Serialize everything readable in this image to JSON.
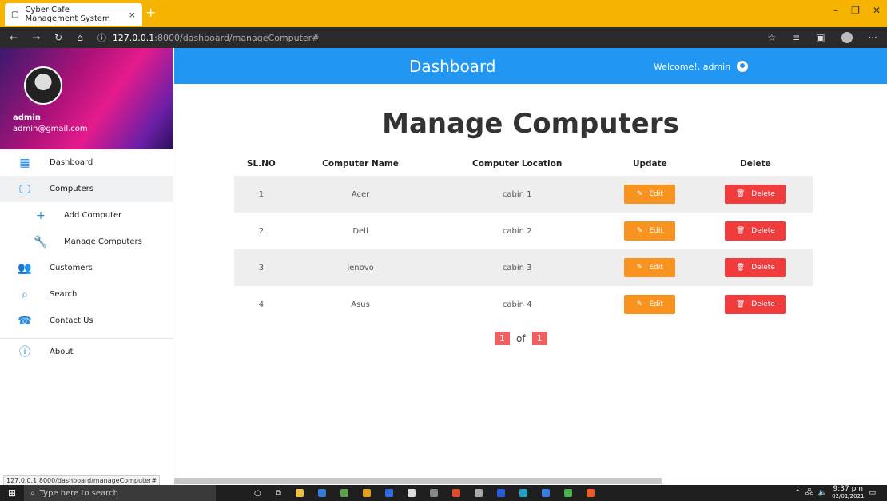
{
  "browser": {
    "tab_title": "Cyber Cafe Management System",
    "tab_close": "×",
    "new_tab": "+",
    "url_host": "127.0.0.1",
    "url_path": ":8000/dashboard/manageComputer#",
    "status_url": "127.0.0.1:8000/dashboard/manageComputer#"
  },
  "sidebar": {
    "name": "admin",
    "email": "admin@gmail.com",
    "items": [
      {
        "label": "Dashboard"
      },
      {
        "label": "Computers"
      },
      {
        "label": "Add Computer"
      },
      {
        "label": "Manage Computers"
      },
      {
        "label": "Customers"
      },
      {
        "label": "Search"
      },
      {
        "label": "Contact Us"
      },
      {
        "label": "About"
      }
    ]
  },
  "header": {
    "title": "Dashboard",
    "welcome": "Welcome!, admin"
  },
  "main": {
    "page_title": "Manage Computers",
    "columns": [
      "SL.NO",
      "Computer Name",
      "Computer Location",
      "Update",
      "Delete"
    ],
    "rows": [
      {
        "sl": "1",
        "name": "Acer",
        "location": "cabin 1"
      },
      {
        "sl": "2",
        "name": "Dell",
        "location": "cabin 2"
      },
      {
        "sl": "3",
        "name": "lenovo",
        "location": "cabin 3"
      },
      {
        "sl": "4",
        "name": "Asus",
        "location": "cabin 4"
      }
    ],
    "edit_label": "Edit",
    "delete_label": "Delete",
    "pager": {
      "current": "1",
      "of": "of",
      "total": "1"
    }
  },
  "taskbar": {
    "search_placeholder": "Type here to search",
    "time": "9:37 pm",
    "date": "02/01/2021"
  },
  "colors": {
    "header": "#2196f3",
    "tabbar": "#f6b400",
    "edit": "#f7931e",
    "delete": "#f03c3c",
    "pager": "#f06060"
  }
}
